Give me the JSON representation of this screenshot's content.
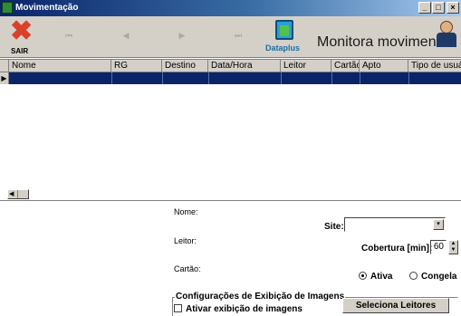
{
  "window": {
    "title": "Movimentação",
    "min": "_",
    "max": "□",
    "close": "×"
  },
  "toolbar": {
    "exit_label": "SAIR",
    "nav": {
      "first": "⏮",
      "prev": "◀",
      "next": "▶",
      "last": "⏭"
    },
    "logo_text": "Dataplus",
    "title": "Monitora movimento"
  },
  "grid": {
    "columns": [
      "Nome",
      "RG",
      "Destino",
      "Data/Hora",
      "Leitor",
      "Cartão",
      "Apto",
      "Tipo de usuário"
    ],
    "row_indicator": "▶",
    "scroll_arrow": "◀"
  },
  "panel": {
    "nome_label": "Nome:",
    "leitor_label": "Leitor:",
    "cartao_label": "Cartão:",
    "site_label": "Site:",
    "site_value": "",
    "dropdown_arrow": "▾",
    "cobertura_label": "Cobertura [min]:",
    "cobertura_value": "60",
    "spin_up": "▲",
    "spin_down": "▼",
    "radio_ativa": "Ativa",
    "radio_congela": "Congela",
    "group_title": "Configurações de Exibição de Imagens",
    "checkbox_label": "Ativar exibição de imagens",
    "select_button": "Seleciona Leitores"
  }
}
